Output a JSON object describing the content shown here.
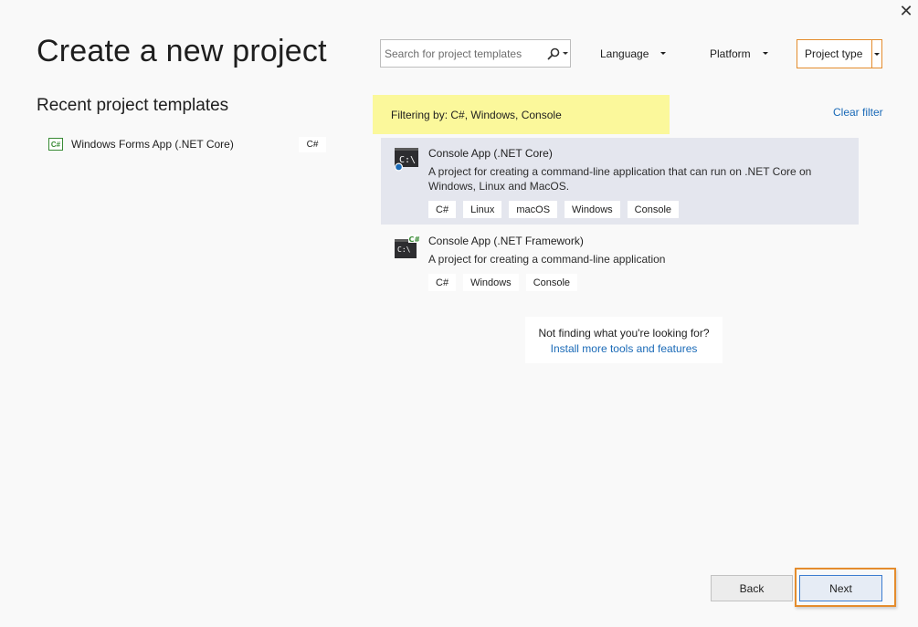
{
  "window": {
    "close_glyph": "✕"
  },
  "page": {
    "title": "Create a new project"
  },
  "recent": {
    "heading": "Recent project templates",
    "items": [
      {
        "label": "Windows Forms App (.NET Core)",
        "icon": "csharp-project-icon",
        "icon_text": "C#",
        "language": "C#"
      }
    ]
  },
  "search": {
    "placeholder": "Search for project templates",
    "value": ""
  },
  "filters": {
    "language": "Language",
    "platform": "Platform",
    "project_type": "Project type",
    "banner": "Filtering by: C#, Windows, Console",
    "clear": "Clear filter"
  },
  "templates": [
    {
      "name": "Console App (.NET Core)",
      "description": "A project for creating a command-line application that can run on .NET Core on Windows, Linux and MacOS.",
      "icon": "console-app-core-icon",
      "selected": true,
      "tags": [
        "C#",
        "Linux",
        "macOS",
        "Windows",
        "Console"
      ]
    },
    {
      "name": "Console App (.NET Framework)",
      "description": "A project for creating a command-line application",
      "icon": "console-app-framework-icon",
      "selected": false,
      "tags": [
        "C#",
        "Windows",
        "Console"
      ]
    }
  ],
  "help": {
    "text": "Not finding what you're looking for?",
    "link": "Install more tools and features"
  },
  "buttons": {
    "back": "Back",
    "next": "Next"
  },
  "colors": {
    "background": "#f9f9f9",
    "accent_orange": "#e48c2d",
    "filter_highlight": "#fbf89b",
    "link_blue": "#1a6ab7",
    "selected_row": "#e4e6ee",
    "csharp_green": "#388a34"
  }
}
